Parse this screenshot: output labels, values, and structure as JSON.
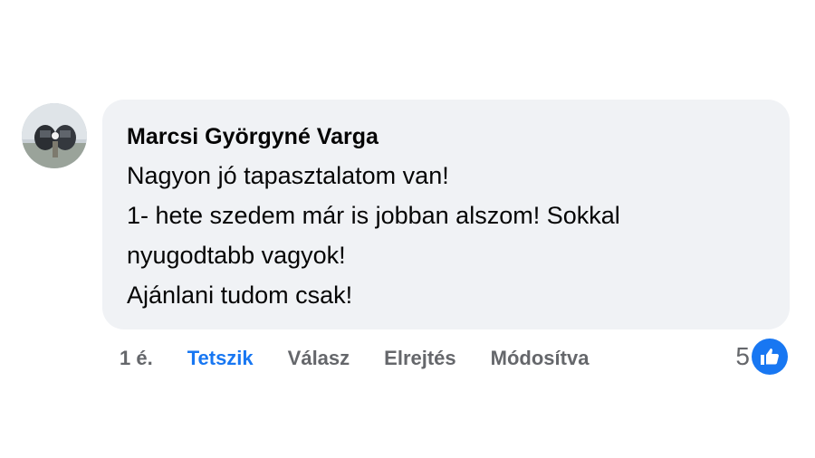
{
  "comment": {
    "author": "Marcsi Györgyné Varga",
    "lines": [
      "Nagyon jó tapasztalatom van!",
      "1- hete szedem már is jobban alszom! Sokkal",
      "nyugodtabb vagyok!",
      "Ajánlani tudom csak!"
    ],
    "avatar_icon": "profile-photo",
    "bubble_color": "#f0f2f5"
  },
  "actions": {
    "time": "1 é.",
    "like_label": "Tetszik",
    "reply_label": "Válasz",
    "hide_label": "Elrejtés",
    "edited_label": "Módosítva",
    "like_color": "#1877f2"
  },
  "reactions": {
    "count": "5",
    "icon": "thumbs-up-icon",
    "color": "#1877f2"
  }
}
